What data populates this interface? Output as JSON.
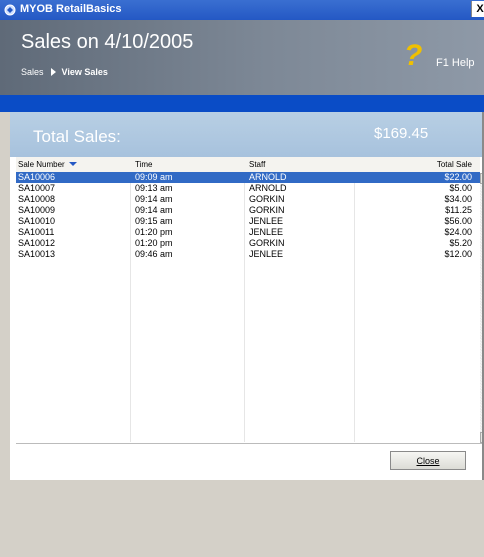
{
  "window": {
    "title": "MYOB RetailBasics",
    "close_label": "X"
  },
  "header": {
    "title": "Sales on 4/10/2005",
    "breadcrumb": [
      "Sales",
      "View Sales"
    ],
    "help_label": "F1 Help",
    "help_icon": "question-mark-icon"
  },
  "summary": {
    "total_label": "Total Sales:",
    "total_value": "$169.45"
  },
  "table": {
    "columns": [
      "Sale Number",
      "Time",
      "Staff",
      "Total Sale"
    ],
    "sort_column": "Sale Number",
    "rows": [
      {
        "sale": "SA10006",
        "time": "09:09 am",
        "staff": "ARNOLD",
        "total": "$22.00",
        "selected": true
      },
      {
        "sale": "SA10007",
        "time": "09:13 am",
        "staff": "ARNOLD",
        "total": "$5.00"
      },
      {
        "sale": "SA10008",
        "time": "09:14 am",
        "staff": "GORKIN",
        "total": "$34.00"
      },
      {
        "sale": "SA10009",
        "time": "09:14 am",
        "staff": "GORKIN",
        "total": "$11.25"
      },
      {
        "sale": "SA10010",
        "time": "09:15 am",
        "staff": "JENLEE",
        "total": "$56.00"
      },
      {
        "sale": "SA10011",
        "time": "01:20 pm",
        "staff": "JENLEE",
        "total": "$24.00"
      },
      {
        "sale": "SA10012",
        "time": "01:20 pm",
        "staff": "GORKIN",
        "total": "$5.20"
      },
      {
        "sale": "SA10013",
        "time": "09:46 am",
        "staff": "JENLEE",
        "total": "$12.00"
      }
    ]
  },
  "footer": {
    "close_label": "Close"
  },
  "colors": {
    "selection": "#316ac5",
    "accent_bar": "#0a4cc6",
    "help_icon": "#f0c000"
  }
}
